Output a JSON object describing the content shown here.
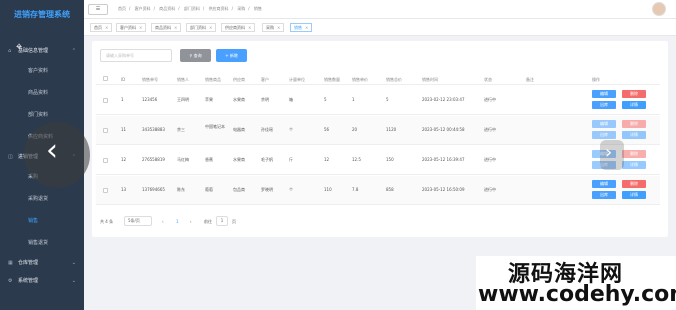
{
  "app": {
    "title": "进销存管理系统"
  },
  "sidebar": {
    "groups": [
      {
        "label": "基础信息管理",
        "items": [
          "客户资料",
          "商品资料",
          "部门资料",
          "供应商资料"
        ]
      },
      {
        "label": "进销管理",
        "items": [
          "采购",
          "采购退货",
          "销售",
          "销售退货"
        ]
      },
      {
        "label": "仓库管理",
        "items": []
      },
      {
        "label": "系统管理",
        "items": []
      }
    ],
    "active_item": "销售"
  },
  "topbar": {
    "toggle": "☰",
    "breadcrumb": [
      "首页",
      "客户资料",
      "商品资料",
      "部门资料",
      "供应商资料",
      "采购",
      "销售"
    ]
  },
  "tags": [
    "首页",
    "客户资料",
    "商品资料",
    "部门资料",
    "供应商资料",
    "采购",
    "销售"
  ],
  "toolbar": {
    "search_placeholder": "请输入采购单号",
    "query_label": "查询",
    "add_label": "新增"
  },
  "table": {
    "columns": [
      "ID",
      "销售单号",
      "销售人",
      "销售商品",
      "供应商",
      "客户",
      "计量单位",
      "销售数量",
      "销售单价",
      "销售总价",
      "销售时间",
      "状态",
      "备注",
      "操作"
    ],
    "rows": [
      {
        "id": "1",
        "no": "123456",
        "seller": "王四明",
        "product": "苹果",
        "supplier": "水果商",
        "customer": "余明",
        "unit": "箱",
        "qty": "5",
        "price": "1",
        "total": "5",
        "time": "2023-02-12 23:03:47",
        "status": "进行中",
        "remark": ""
      },
      {
        "id": "11",
        "no": "343538883",
        "seller": "余三",
        "product": "中国笔记本",
        "supplier": "电器商",
        "customer": "孙佳瑶",
        "unit": "个",
        "qty": "56",
        "price": "20",
        "total": "1120",
        "time": "2023-05-12 00:44:58",
        "status": "进行中",
        "remark": ""
      },
      {
        "id": "12",
        "no": "276558819",
        "seller": "马红梅",
        "product": "香蕉",
        "supplier": "水果商",
        "customer": "毛子帆",
        "unit": "斤",
        "qty": "12",
        "price": "12.5",
        "total": "150",
        "time": "2023-05-12 16:39:47",
        "status": "进行中",
        "remark": ""
      },
      {
        "id": "13",
        "no": "137694665",
        "seller": "陈东",
        "product": "葡萄",
        "supplier": "包品商",
        "customer": "罗晓明",
        "unit": "个",
        "qty": "110",
        "price": "7.8",
        "total": "858",
        "time": "2023-05-12 16:50:09",
        "status": "进行中",
        "remark": ""
      }
    ],
    "actions": {
      "edit": "编辑",
      "delete": "删除",
      "ship": "出库",
      "view": "详情"
    }
  },
  "pager": {
    "total": "共 4 条",
    "page_size": "5条/页",
    "prev": "‹",
    "page": "1",
    "next": "›",
    "goto": "前往",
    "goto_value": "1",
    "unit": "页"
  },
  "watermark": {
    "line1": "源码海洋网",
    "line2": "www.codehy.com"
  },
  "overlay": {
    "left": "‹",
    "right": "›"
  }
}
